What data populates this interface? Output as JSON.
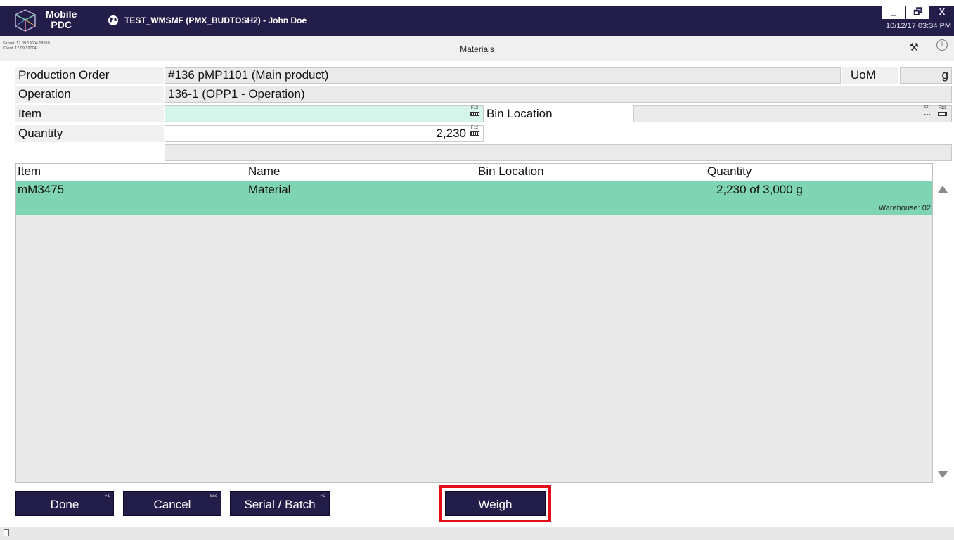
{
  "app": {
    "name_line1": "Mobile",
    "name_line2": "PDC",
    "window_title": "TEST_WMSMF (PMX_BUDTOSH2) - John Doe",
    "datetime": "10/12/17 03:34 PM",
    "window_buttons": {
      "minimize": "_",
      "restore": "🗗",
      "close": "X"
    }
  },
  "subheader": {
    "server_version": "Server: 17.09.19004.18920",
    "client_version": "Client: 17.09.19004",
    "screen_title": "Materials",
    "tools_icon": "⚒",
    "info_icon": "ⓘ"
  },
  "form": {
    "production_order": {
      "label": "Production Order",
      "value": "#136 pMP1101 (Main product)"
    },
    "uom": {
      "label": "UoM",
      "value": "g"
    },
    "operation": {
      "label": "Operation",
      "value": "136-1 (OPP1 - Operation)"
    },
    "item": {
      "label": "Item",
      "value": "",
      "key": "F12"
    },
    "bin_location": {
      "label": "Bin Location",
      "value": "",
      "key_browse": "F11",
      "key_keyboard": "F12",
      "browse_label": "..."
    },
    "quantity": {
      "label": "Quantity",
      "value": "2,230",
      "key": "F12"
    },
    "message": ""
  },
  "grid": {
    "columns": [
      "Item",
      "Name",
      "Bin Location",
      "Quantity"
    ],
    "rows": [
      {
        "item": "mM3475",
        "name": "Material",
        "bin_location": "",
        "quantity": "2,230 of 3,000 g",
        "warehouse": "Warehouse: 02"
      }
    ]
  },
  "buttons": {
    "done": {
      "label": "Done",
      "key": "F1"
    },
    "cancel": {
      "label": "Cancel",
      "key": "Esc"
    },
    "serial_batch": {
      "label": "Serial / Batch",
      "key": "F2"
    },
    "weigh": {
      "label": "Weigh"
    }
  },
  "colors": {
    "titlebar": "#231e49",
    "selected_row": "#7fd4b4",
    "active_field": "#d6f5ea",
    "highlight": "#e3101a"
  }
}
